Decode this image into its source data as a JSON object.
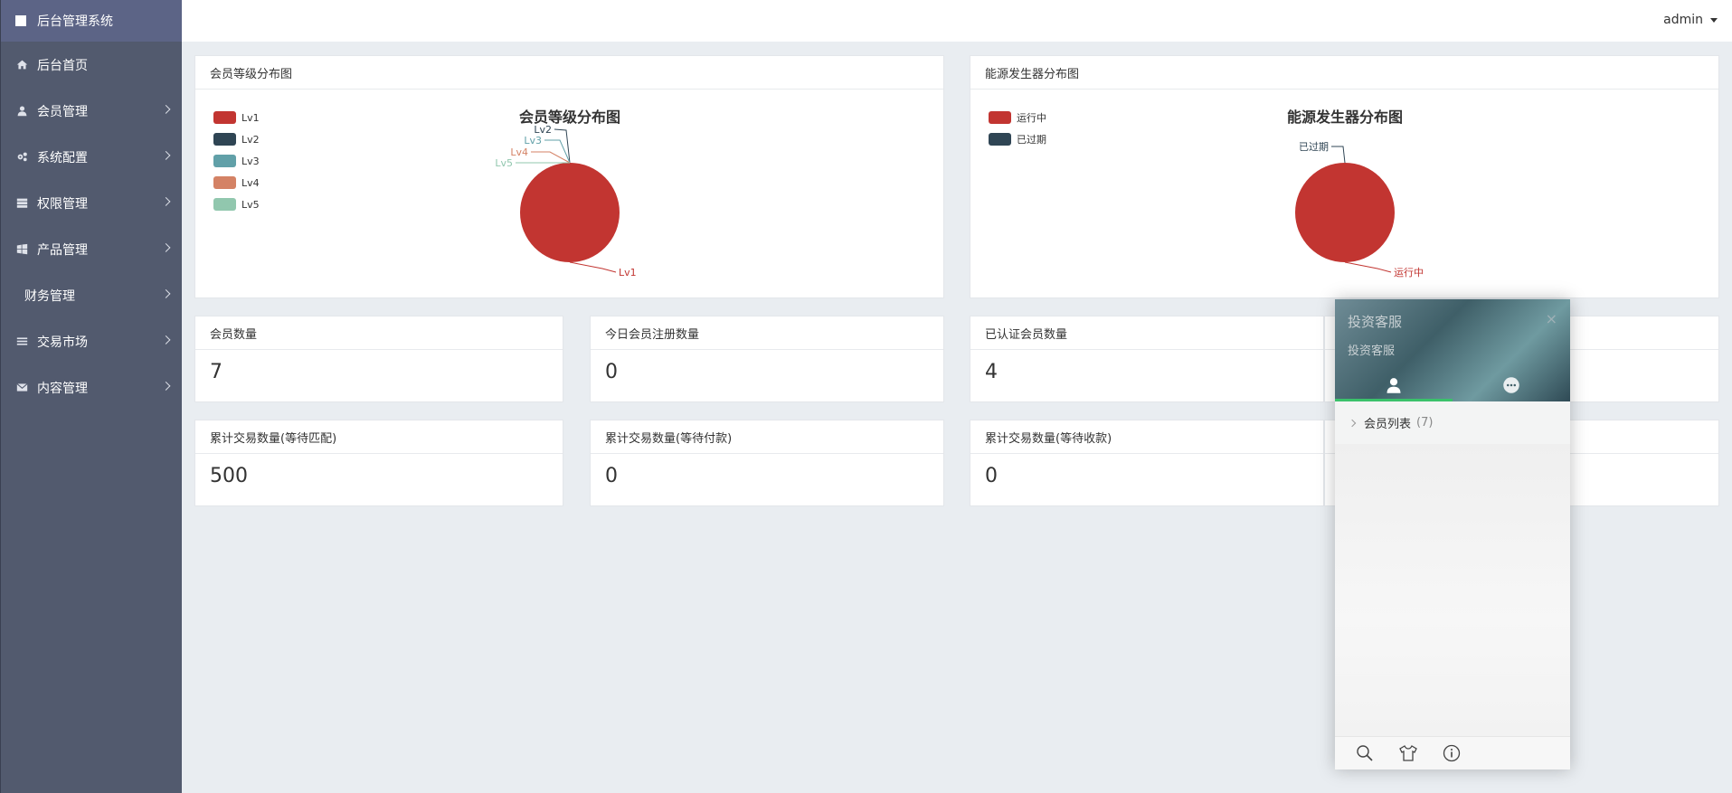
{
  "sidebar": {
    "brand": "后台管理系统",
    "items": [
      {
        "label": "后台首页",
        "icon": "home-icon",
        "chevron": false
      },
      {
        "label": "会员管理",
        "icon": "user-icon",
        "chevron": true
      },
      {
        "label": "系统配置",
        "icon": "cogs-icon",
        "chevron": true
      },
      {
        "label": "权限管理",
        "icon": "server-icon",
        "chevron": true
      },
      {
        "label": "产品管理",
        "icon": "windows-icon",
        "chevron": true
      },
      {
        "label": "财务管理",
        "icon": "",
        "chevron": true
      },
      {
        "label": "交易市场",
        "icon": "list-icon",
        "chevron": true
      },
      {
        "label": "内容管理",
        "icon": "envelope-icon",
        "chevron": true
      }
    ]
  },
  "header": {
    "user": "admin"
  },
  "panels": {
    "member_chart": {
      "header": "会员等级分布图",
      "title": "会员等级分布图"
    },
    "energy_chart": {
      "header": "能源发生器分布图",
      "title": "能源发生器分布图"
    }
  },
  "chart_data": [
    {
      "type": "pie",
      "title": "会员等级分布图",
      "legend_position": "top-left",
      "categories": [
        "Lv1",
        "Lv2",
        "Lv3",
        "Lv4",
        "Lv5"
      ],
      "values": [
        7,
        0,
        0,
        0,
        0
      ],
      "colors": [
        "#c23531",
        "#2f4554",
        "#61a0a8",
        "#d48265",
        "#91c7ae"
      ]
    },
    {
      "type": "pie",
      "title": "能源发生器分布图",
      "legend_position": "top-left",
      "categories": [
        "运行中",
        "已过期"
      ],
      "values": [
        1,
        0
      ],
      "colors": [
        "#c23531",
        "#2f4554"
      ]
    }
  ],
  "stats": [
    {
      "label": "会员数量",
      "value": "7"
    },
    {
      "label": "今日会员注册数量",
      "value": "0"
    },
    {
      "label": "已认证会员数量",
      "value": "4"
    },
    {
      "label": "累计交易数量(等待匹配)",
      "value": "500"
    },
    {
      "label": "累计交易数量(等待付款)",
      "value": "0"
    },
    {
      "label": "累计交易数量(等待收款)",
      "value": "0"
    }
  ],
  "chat": {
    "title": "投资客服",
    "subtitle": "投资客服",
    "close": "×",
    "list_label": "会员列表",
    "list_count": "(7)",
    "accent": "#3bc16b"
  }
}
